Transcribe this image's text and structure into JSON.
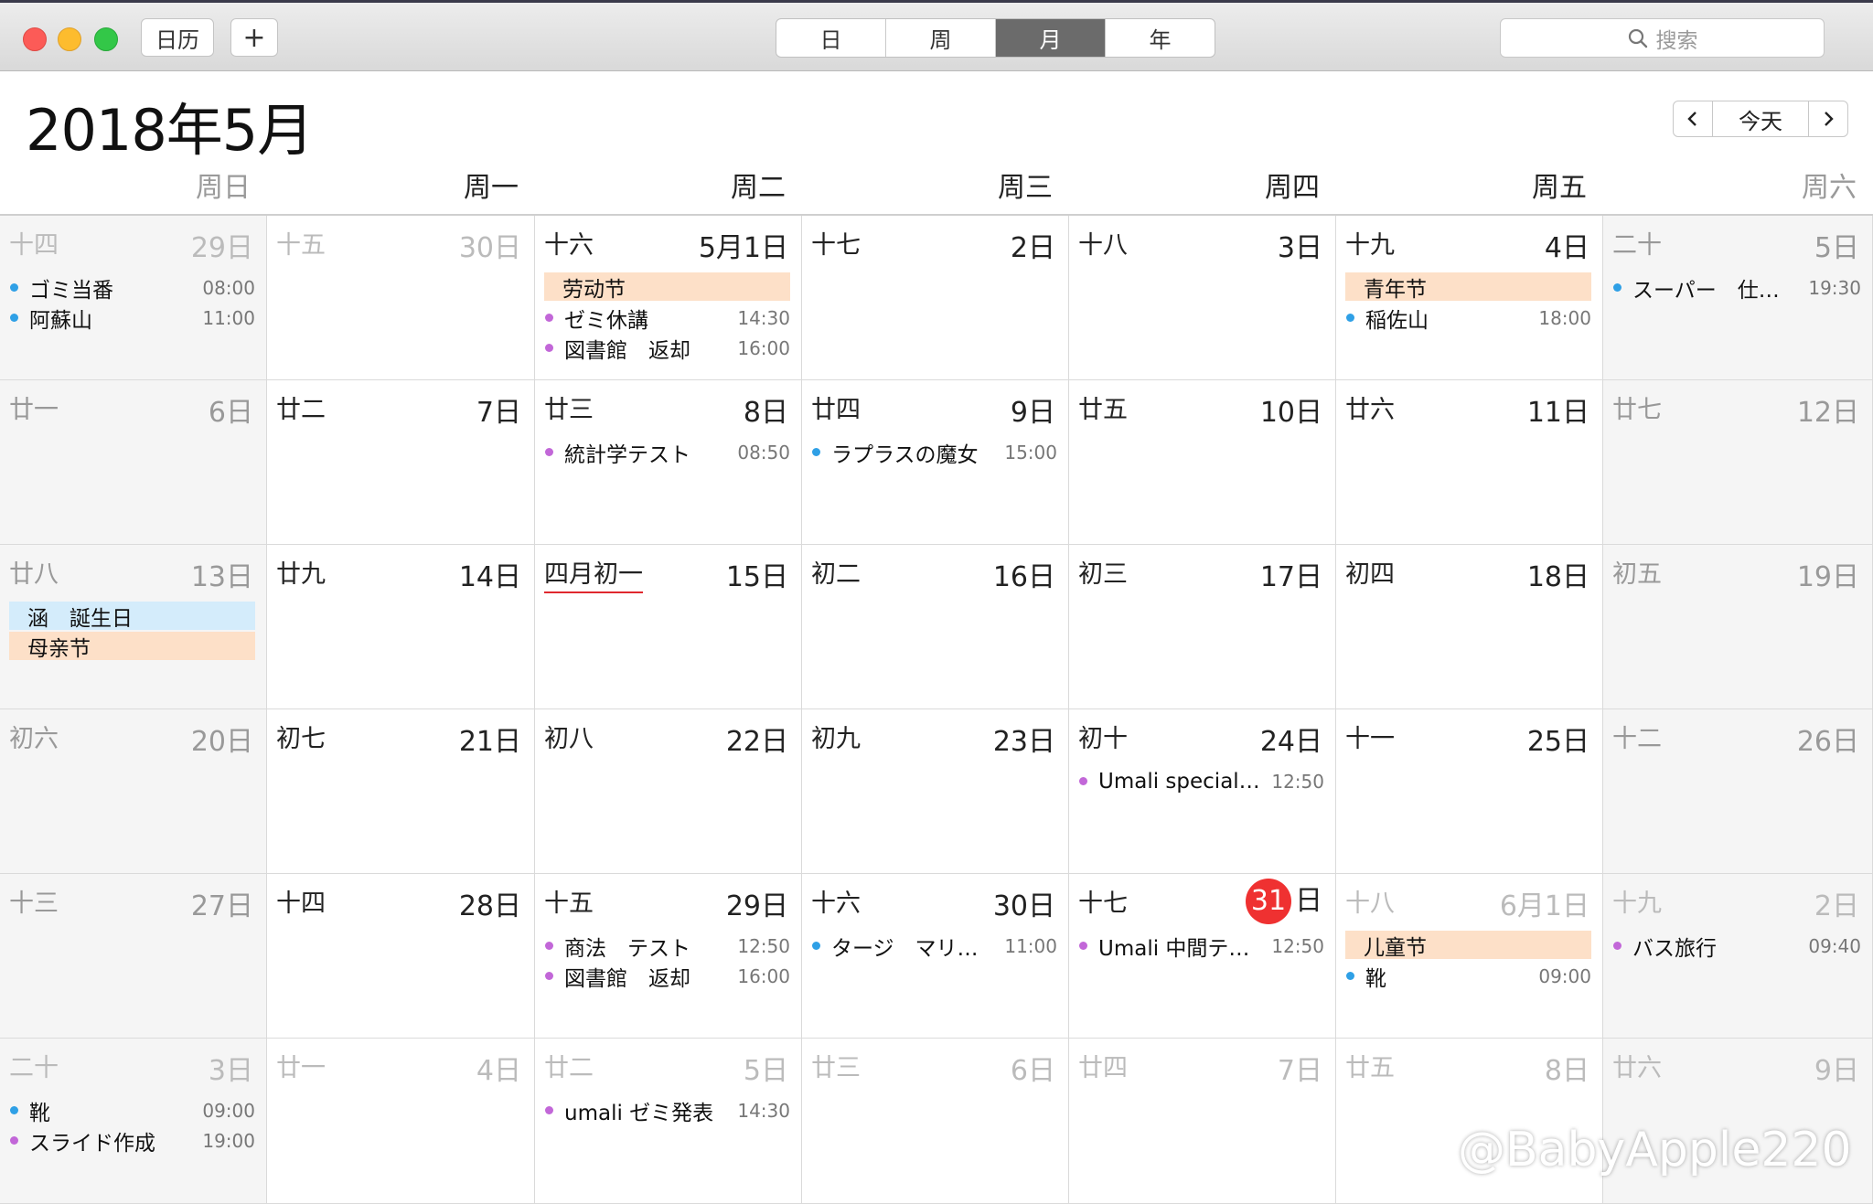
{
  "toolbar": {
    "calendars_label": "日历",
    "add_label": "+",
    "views": [
      "日",
      "周",
      "月",
      "年"
    ],
    "active_view": "月",
    "search_placeholder": "搜索"
  },
  "header": {
    "title": "2018年5月",
    "today_label": "今天",
    "prev_label": "‹",
    "next_label": "›"
  },
  "weekdays": [
    "周日",
    "周一",
    "周二",
    "周三",
    "周四",
    "周五",
    "周六"
  ],
  "colors": {
    "event_blue": "#2fa0e6",
    "event_purple": "#c267d8",
    "holiday_bg": "#fde0c8",
    "birthday_bg": "#d4ecfb",
    "today_red": "#ef3131"
  },
  "weeks": [
    [
      {
        "lunar": "十四",
        "day": "29日",
        "other": true,
        "events": [
          {
            "title": "ゴミ当番",
            "time": "08:00",
            "color": "blue"
          },
          {
            "title": "阿蘇山",
            "time": "11:00",
            "color": "blue"
          }
        ]
      },
      {
        "lunar": "十五",
        "day": "30日",
        "other": true,
        "events": []
      },
      {
        "lunar": "十六",
        "day": "5月1日",
        "events": [
          {
            "title": "劳动节",
            "allday": "holiday"
          },
          {
            "title": "ゼミ休講",
            "time": "14:30",
            "color": "purple"
          },
          {
            "title": "図書館　返却",
            "time": "16:00",
            "color": "purple"
          }
        ]
      },
      {
        "lunar": "十七",
        "day": "2日",
        "events": []
      },
      {
        "lunar": "十八",
        "day": "3日",
        "events": []
      },
      {
        "lunar": "十九",
        "day": "4日",
        "events": [
          {
            "title": "青年节",
            "allday": "holiday"
          },
          {
            "title": "稲佐山",
            "time": "18:00",
            "color": "blue"
          }
        ]
      },
      {
        "lunar": "二十",
        "day": "5日",
        "events": [
          {
            "title": "スーパー　仕…",
            "time": "19:30",
            "color": "blue"
          }
        ]
      }
    ],
    [
      {
        "lunar": "廿一",
        "day": "6日",
        "events": []
      },
      {
        "lunar": "廿二",
        "day": "7日",
        "events": []
      },
      {
        "lunar": "廿三",
        "day": "8日",
        "events": [
          {
            "title": "統計学テスト",
            "time": "08:50",
            "color": "purple"
          }
        ]
      },
      {
        "lunar": "廿四",
        "day": "9日",
        "events": [
          {
            "title": "ラプラスの魔女",
            "time": "15:00",
            "color": "blue"
          }
        ]
      },
      {
        "lunar": "廿五",
        "day": "10日",
        "events": []
      },
      {
        "lunar": "廿六",
        "day": "11日",
        "events": []
      },
      {
        "lunar": "廿七",
        "day": "12日",
        "events": []
      }
    ],
    [
      {
        "lunar": "廿八",
        "day": "13日",
        "events": [
          {
            "title": "涵　誕生日",
            "allday": "birthday"
          },
          {
            "title": "母亲节",
            "allday": "holiday"
          }
        ]
      },
      {
        "lunar": "廿九",
        "day": "14日",
        "events": []
      },
      {
        "lunar": "四月初一",
        "day": "15日",
        "newmonth": true,
        "events": []
      },
      {
        "lunar": "初二",
        "day": "16日",
        "events": []
      },
      {
        "lunar": "初三",
        "day": "17日",
        "events": []
      },
      {
        "lunar": "初四",
        "day": "18日",
        "events": []
      },
      {
        "lunar": "初五",
        "day": "19日",
        "events": []
      }
    ],
    [
      {
        "lunar": "初六",
        "day": "20日",
        "events": []
      },
      {
        "lunar": "初七",
        "day": "21日",
        "events": []
      },
      {
        "lunar": "初八",
        "day": "22日",
        "events": []
      },
      {
        "lunar": "初九",
        "day": "23日",
        "events": []
      },
      {
        "lunar": "初十",
        "day": "24日",
        "events": [
          {
            "title": "Umali special…",
            "time": "12:50",
            "color": "purple"
          }
        ]
      },
      {
        "lunar": "十一",
        "day": "25日",
        "events": []
      },
      {
        "lunar": "十二",
        "day": "26日",
        "events": []
      }
    ],
    [
      {
        "lunar": "十三",
        "day": "27日",
        "events": []
      },
      {
        "lunar": "十四",
        "day": "28日",
        "events": []
      },
      {
        "lunar": "十五",
        "day": "29日",
        "events": [
          {
            "title": "商法　テスト",
            "time": "12:50",
            "color": "purple"
          },
          {
            "title": "図書館　返却",
            "time": "16:00",
            "color": "purple"
          }
        ]
      },
      {
        "lunar": "十六",
        "day": "30日",
        "events": [
          {
            "title": "タージ　マリ…",
            "time": "11:00",
            "color": "blue"
          }
        ]
      },
      {
        "lunar": "十七",
        "day": "日",
        "today_num": "31",
        "events": [
          {
            "title": "Umali 中間テ…",
            "time": "12:50",
            "color": "purple"
          }
        ]
      },
      {
        "lunar": "十八",
        "day": "6月1日",
        "other": true,
        "events": [
          {
            "title": "儿童节",
            "allday": "holiday"
          },
          {
            "title": "靴",
            "time": "09:00",
            "color": "blue"
          }
        ]
      },
      {
        "lunar": "十九",
        "day": "2日",
        "other": true,
        "events": [
          {
            "title": "バス旅行",
            "time": "09:40",
            "color": "purple"
          }
        ]
      }
    ],
    [
      {
        "lunar": "二十",
        "day": "3日",
        "other": true,
        "events": [
          {
            "title": "靴",
            "time": "09:00",
            "color": "blue"
          },
          {
            "title": "スライド作成",
            "time": "19:00",
            "color": "purple"
          }
        ]
      },
      {
        "lunar": "廿一",
        "day": "4日",
        "other": true,
        "events": []
      },
      {
        "lunar": "廿二",
        "day": "5日",
        "other": true,
        "events": [
          {
            "title": "umali ゼミ発表",
            "time": "14:30",
            "color": "purple"
          }
        ]
      },
      {
        "lunar": "廿三",
        "day": "6日",
        "other": true,
        "events": []
      },
      {
        "lunar": "廿四",
        "day": "7日",
        "other": true,
        "events": []
      },
      {
        "lunar": "廿五",
        "day": "8日",
        "other": true,
        "events": []
      },
      {
        "lunar": "廿六",
        "day": "9日",
        "other": true,
        "events": []
      }
    ]
  ],
  "watermark": "@BabyApple220"
}
